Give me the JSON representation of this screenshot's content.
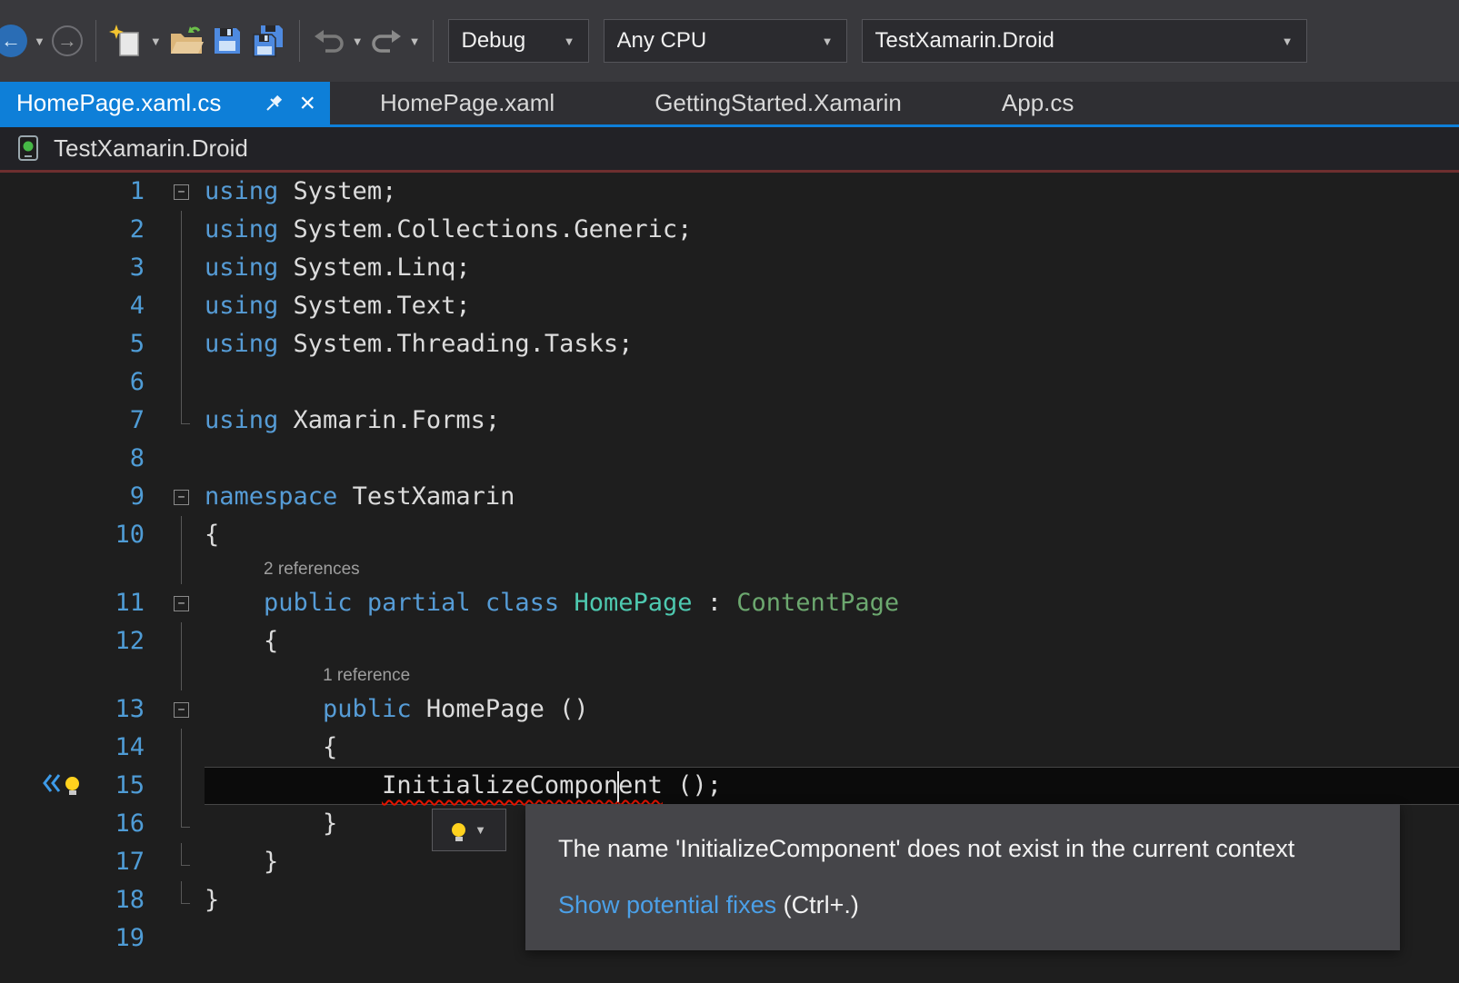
{
  "colors": {
    "accent": "#0E7FD8",
    "keyword": "#569CD6",
    "plain": "#DCDCDC",
    "type": "#4EC9B0",
    "type2": "#6CA86F",
    "error": "#E51400",
    "linenum": "#4F9CD6",
    "link": "#4BA0E8",
    "editor_bg": "#1E1E1E",
    "current_line_bg": "#0B0B0B",
    "tooltip_bg": "#454549"
  },
  "icons": {
    "caret_down": "▼",
    "close": "×",
    "collapse": "−",
    "back_arrow": "←",
    "forward_arrow": "→"
  },
  "toolbar": {
    "dropdowns": [
      {
        "id": "solution-configuration",
        "label": "Debug"
      },
      {
        "id": "solution-platform",
        "label": "Any CPU"
      },
      {
        "id": "startup-project",
        "label": "TestXamarin.Droid"
      }
    ]
  },
  "tabs": [
    {
      "label": "HomePage.xaml.cs",
      "active": true
    },
    {
      "label": "HomePage.xaml"
    },
    {
      "label": "GettingStarted.Xamarin"
    },
    {
      "label": "App.cs"
    }
  ],
  "breadcrumb": {
    "project": "TestXamarin.Droid"
  },
  "editor": {
    "lines": [
      {
        "n": 1,
        "fold": "box",
        "tokens": [
          {
            "t": "using",
            "c": "k"
          },
          {
            "t": " System;",
            "c": "p"
          }
        ]
      },
      {
        "n": 2,
        "fold": "line",
        "tokens": [
          {
            "t": "using",
            "c": "k"
          },
          {
            "t": " System.Collections.Generic;",
            "c": "p"
          }
        ]
      },
      {
        "n": 3,
        "fold": "line",
        "tokens": [
          {
            "t": "using",
            "c": "k"
          },
          {
            "t": " System.Linq;",
            "c": "p"
          }
        ]
      },
      {
        "n": 4,
        "fold": "line",
        "tokens": [
          {
            "t": "using",
            "c": "k"
          },
          {
            "t": " System.Text;",
            "c": "p"
          }
        ]
      },
      {
        "n": 5,
        "fold": "line",
        "tokens": [
          {
            "t": "using",
            "c": "k"
          },
          {
            "t": " System.Threading.Tasks;",
            "c": "p"
          }
        ]
      },
      {
        "n": 6,
        "fold": "line",
        "tokens": []
      },
      {
        "n": 7,
        "fold": "end",
        "tokens": [
          {
            "t": "using",
            "c": "k"
          },
          {
            "t": " Xamarin.Forms;",
            "c": "p"
          }
        ]
      },
      {
        "n": 8,
        "fold": "",
        "tokens": []
      },
      {
        "n": 9,
        "fold": "box",
        "tokens": [
          {
            "t": "namespace",
            "c": "k"
          },
          {
            "t": " TestXamarin",
            "c": "p"
          }
        ]
      },
      {
        "n": 10,
        "fold": "line",
        "tokens": [
          {
            "t": "{",
            "c": "p"
          }
        ]
      },
      {
        "n": 11,
        "fold": "box",
        "codelens": "2 references",
        "codelens_indent": 4,
        "tokens": [
          {
            "t": "    ",
            "c": "p"
          },
          {
            "t": "public",
            "c": "k"
          },
          {
            "t": " ",
            "c": "p"
          },
          {
            "t": "partial",
            "c": "k"
          },
          {
            "t": " ",
            "c": "p"
          },
          {
            "t": "class",
            "c": "k"
          },
          {
            "t": " ",
            "c": "p"
          },
          {
            "t": "HomePage",
            "c": "t"
          },
          {
            "t": " : ",
            "c": "p"
          },
          {
            "t": "ContentPage",
            "c": "t2"
          }
        ]
      },
      {
        "n": 12,
        "fold": "line",
        "tokens": [
          {
            "t": "    {",
            "c": "p"
          }
        ]
      },
      {
        "n": 13,
        "fold": "box",
        "codelens": "1 reference",
        "codelens_indent": 8,
        "tokens": [
          {
            "t": "        ",
            "c": "p"
          },
          {
            "t": "public",
            "c": "k"
          },
          {
            "t": " HomePage ()",
            "c": "p"
          }
        ]
      },
      {
        "n": 14,
        "fold": "line",
        "tokens": [
          {
            "t": "        {",
            "c": "p"
          }
        ]
      },
      {
        "n": 15,
        "fold": "line",
        "current": true,
        "tokens": [
          {
            "t": "            ",
            "c": "p"
          },
          {
            "t": "InitializeCompon",
            "c": "e"
          },
          {
            "t": "",
            "c": "caret"
          },
          {
            "t": "ent",
            "c": "e"
          },
          {
            "t": " ();",
            "c": "p"
          }
        ]
      },
      {
        "n": 16,
        "fold": "end",
        "tokens": [
          {
            "t": "        }",
            "c": "p"
          }
        ]
      },
      {
        "n": 17,
        "fold": "end",
        "tokens": [
          {
            "t": "    }",
            "c": "p"
          }
        ]
      },
      {
        "n": 18,
        "fold": "end",
        "tokens": [
          {
            "t": "}",
            "c": "p"
          }
        ]
      },
      {
        "n": 19,
        "fold": "",
        "tokens": []
      }
    ]
  },
  "tooltip": {
    "message": "The name 'InitializeComponent' does not exist in the current context",
    "link": "Show potential fixes",
    "shortcut": "(Ctrl+.)"
  }
}
